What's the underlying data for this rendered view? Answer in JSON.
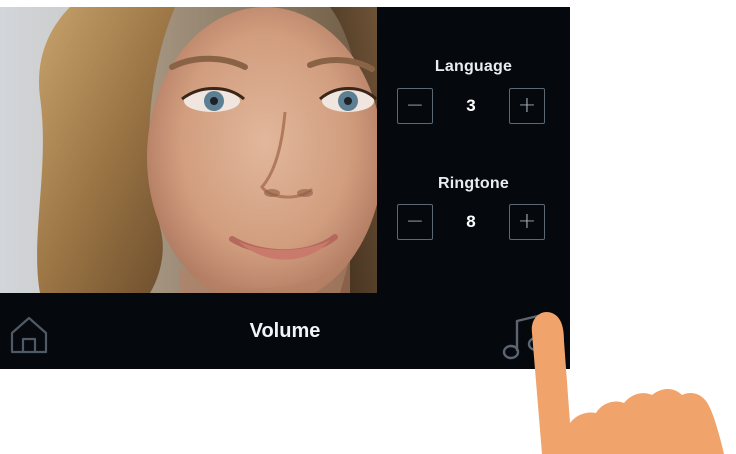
{
  "settings": {
    "language": {
      "label": "Language",
      "value": "3",
      "decrement": "−",
      "increment": "+"
    },
    "ringtone": {
      "label": "Ringtone",
      "value": "8",
      "decrement": "−",
      "increment": "+"
    }
  },
  "bottom_bar": {
    "title": "Volume",
    "left_icon": "home-icon",
    "right_icon": "music-note-icon"
  },
  "camera": {
    "feed_subject": "visitor-face-photo"
  },
  "overlay": {
    "pointer_icon": "hand-pointer-icon",
    "pointer_color": "#f0a36b"
  },
  "colors": {
    "screen_bg": "#05080d",
    "text": "#e9edf2",
    "stepper_border": "#5d6875"
  }
}
